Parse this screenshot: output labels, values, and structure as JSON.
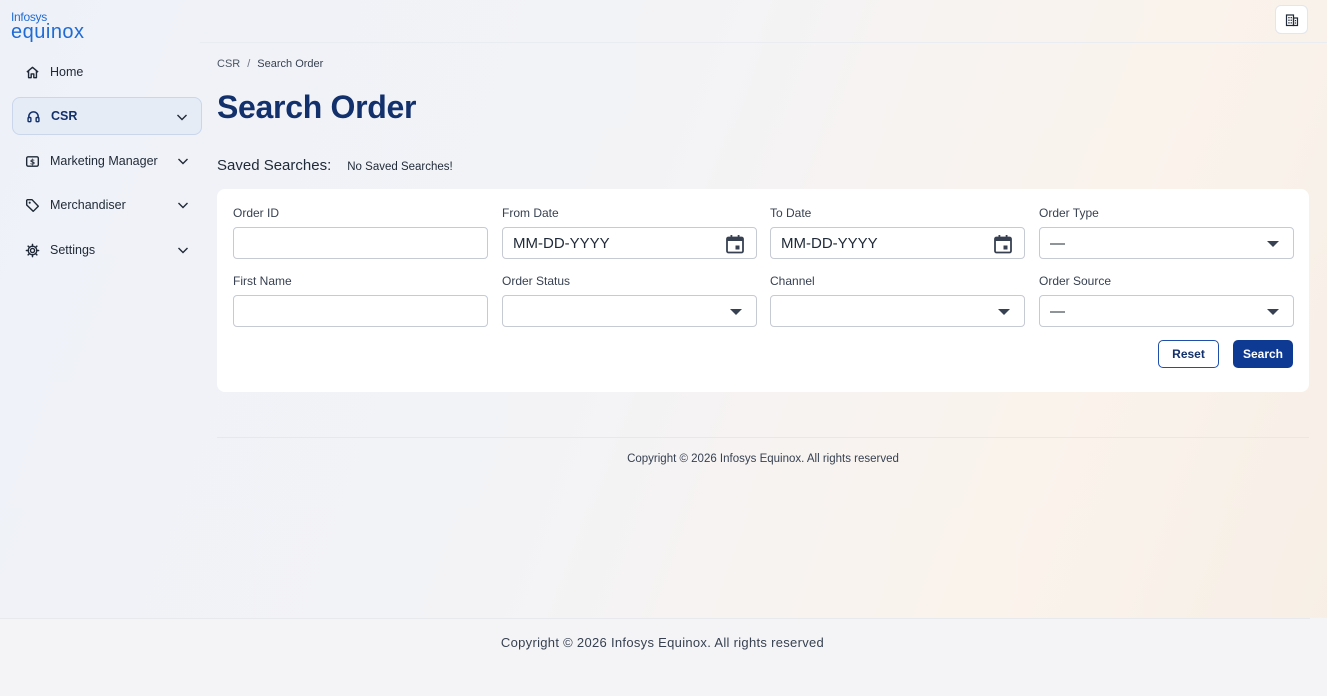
{
  "brand": {
    "top": "Infosys",
    "main": "equinox"
  },
  "header": {
    "action_icon": "building-icon"
  },
  "sidebar": {
    "items": [
      {
        "label": "Home",
        "icon": "home-icon",
        "expandable": false,
        "active": false
      },
      {
        "label": "CSR",
        "icon": "headset-icon",
        "expandable": true,
        "active": true
      },
      {
        "label": "Marketing Manager",
        "icon": "dollar-box-icon",
        "expandable": true,
        "active": false
      },
      {
        "label": "Merchandiser",
        "icon": "tag-icon",
        "expandable": true,
        "active": false
      },
      {
        "label": "Settings",
        "icon": "gear-icon",
        "expandable": true,
        "active": false
      }
    ]
  },
  "breadcrumb": {
    "parent": "CSR",
    "separator": "/",
    "current": "Search Order"
  },
  "page": {
    "title": "Search Order"
  },
  "saved_searches": {
    "label": "Saved Searches:",
    "value": "No Saved Searches!"
  },
  "form": {
    "order_id": {
      "label": "Order ID",
      "value": ""
    },
    "from_date": {
      "label": "From Date",
      "placeholder": "MM-DD-YYYY"
    },
    "to_date": {
      "label": "To Date",
      "placeholder": "MM-DD-YYYY"
    },
    "order_type": {
      "label": "Order Type",
      "value": "—"
    },
    "first_name": {
      "label": "First Name",
      "value": ""
    },
    "order_status": {
      "label": "Order Status",
      "value": ""
    },
    "channel": {
      "label": "Channel",
      "value": ""
    },
    "order_source": {
      "label": "Order Source",
      "value": "—"
    },
    "reset_label": "Reset",
    "search_label": "Search"
  },
  "footer": {
    "inner_copyright": "Copyright © 2026 Infosys Equinox. All rights reserved",
    "outer_copyright": "Copyright © 2026 Infosys Equinox. All rights reserved"
  },
  "colors": {
    "primary": "#0f3a94",
    "title": "#12306b",
    "brand": "#1f6bd6"
  }
}
